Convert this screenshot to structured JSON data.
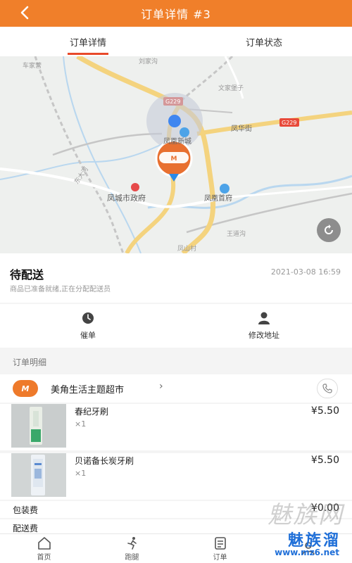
{
  "header": {
    "title": "订单详情 #3"
  },
  "tabs": [
    {
      "label": "订单详情",
      "active": true
    },
    {
      "label": "订单状态",
      "active": false
    }
  ],
  "map": {
    "labels": [
      "车家营",
      "刘家沟",
      "文家堡子",
      "G229",
      "G229",
      "凤华街",
      "凤凰新城",
      "凤城市政府",
      "凤凰首府",
      "王道沟",
      "东大河",
      "凤山村"
    ],
    "marker_text": "美角超市"
  },
  "status": {
    "title": "待配送",
    "time": "2021-03-08 16:59",
    "desc": "商品已准备就绪,正在分配配送员"
  },
  "actions": [
    {
      "label": "催单",
      "icon": "clock-icon"
    },
    {
      "label": "修改地址",
      "icon": "person-icon"
    }
  ],
  "section": {
    "title": "订单明细"
  },
  "shop": {
    "name": "美角生活主题超市",
    "logo_text": "M"
  },
  "items": [
    {
      "name": "春纪牙刷",
      "qty": "×1",
      "price": "¥5.50"
    },
    {
      "name": "贝诺备长炭牙刷",
      "qty": "×1",
      "price": "¥5.50"
    }
  ],
  "fees": [
    {
      "label": "包装费",
      "value": "¥0.00"
    },
    {
      "label": "配送费",
      "value": ""
    }
  ],
  "bottom_nav": [
    {
      "label": "首页",
      "icon": "home-icon"
    },
    {
      "label": "跑腿",
      "icon": "runner-icon"
    },
    {
      "label": "订单",
      "icon": "order-icon"
    },
    {
      "label": "",
      "icon": "user-icon"
    }
  ],
  "watermark": {
    "big": "魅族网",
    "brand": "魅族溜",
    "url": "www.mz6.net"
  },
  "colors": {
    "brand": "#f07f2a",
    "tab_indicator": "#e84a2a",
    "watermark_blue": "#1f6fd8"
  }
}
